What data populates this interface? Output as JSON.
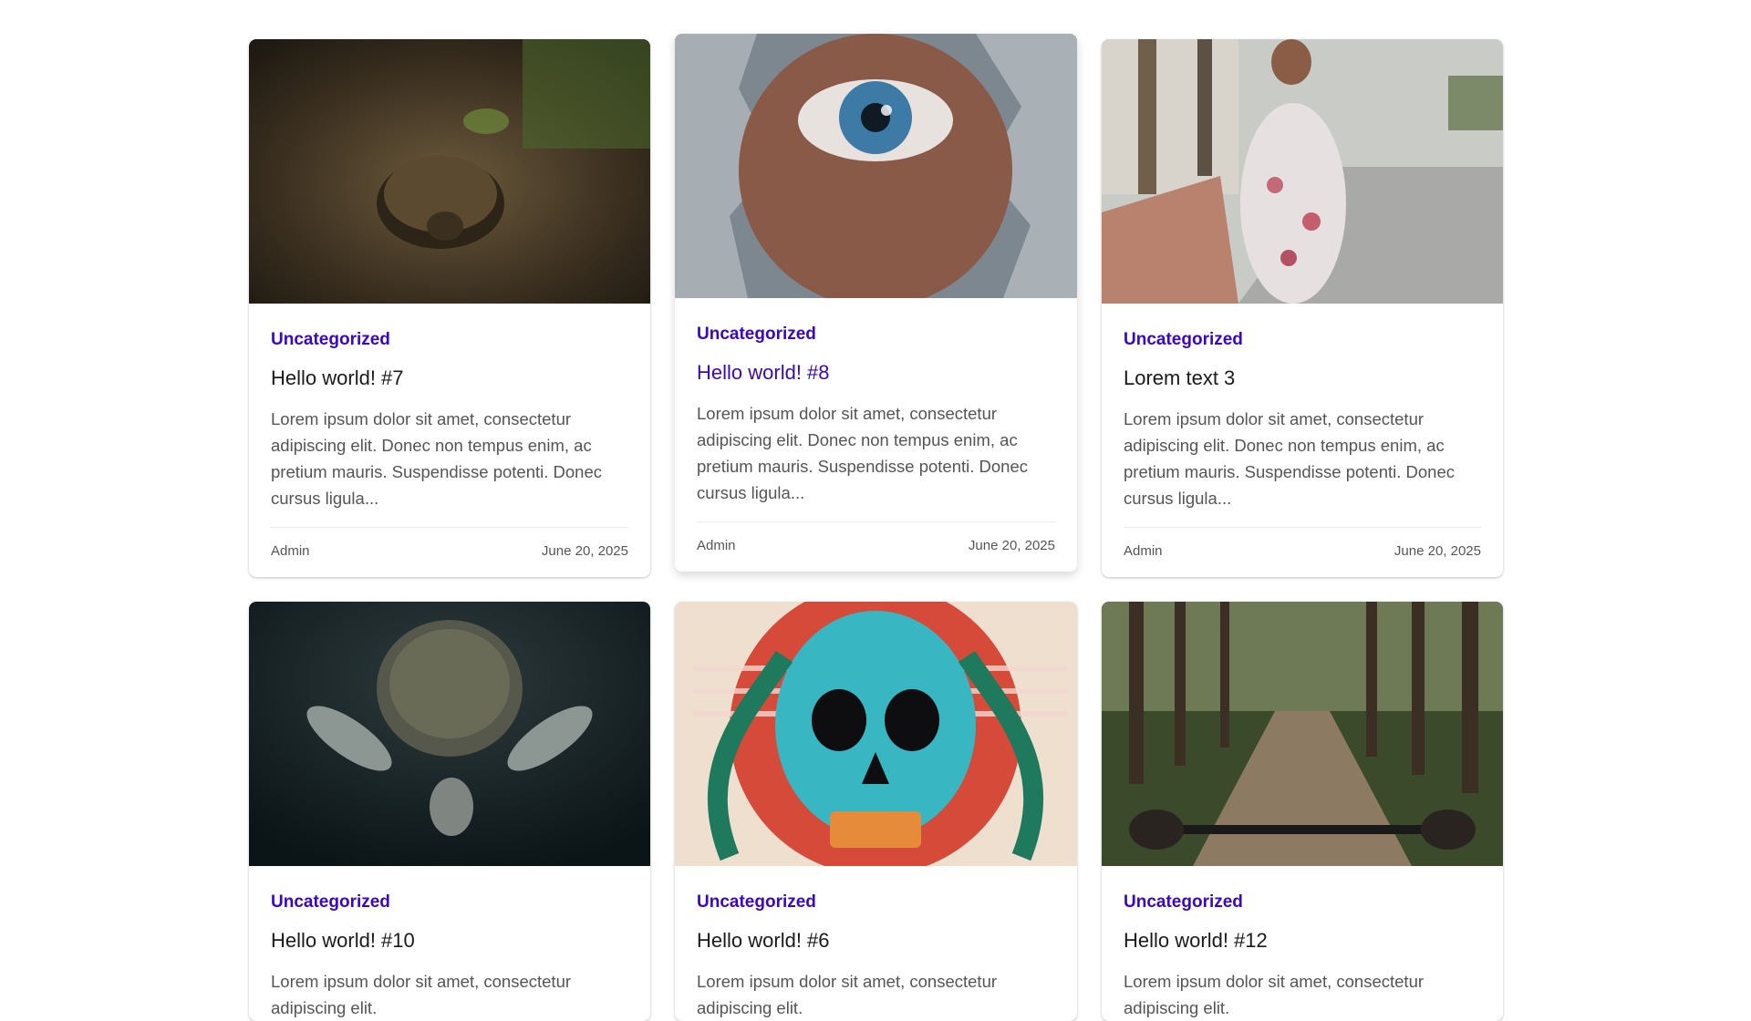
{
  "posts": [
    {
      "image": "tortoise-on-forest-path",
      "category": "Uncategorized",
      "title": "Hello world! #7",
      "excerpt": "Lorem ipsum dolor sit amet, consectetur adipiscing elit. Donec non tempus enim, ac pretium mauris. Suspendisse potenti. Donec cursus ligula...",
      "author": "Admin",
      "date": "June 20, 2025"
    },
    {
      "image": "eye-through-torn-wall",
      "category": "Uncategorized",
      "title": "Hello world! #8",
      "excerpt": "Lorem ipsum dolor sit amet, consectetur adipiscing elit. Donec non tempus enim, ac pretium mauris. Suspendisse potenti. Donec cursus ligula...",
      "author": "Admin",
      "date": "June 20, 2025"
    },
    {
      "image": "woman-floral-dress-street",
      "category": "Uncategorized",
      "title": "Lorem text 3",
      "excerpt": "Lorem ipsum dolor sit amet, consectetur adipiscing elit. Donec non tempus enim, ac pretium mauris. Suspendisse potenti. Donec cursus ligula...",
      "author": "Admin",
      "date": "June 20, 2025"
    },
    {
      "image": "sea-turtle-underwater",
      "category": "Uncategorized",
      "title": "Hello world! #10",
      "excerpt": "Lorem ipsum dolor sit amet, consectetur adipiscing elit.",
      "author": "",
      "date": ""
    },
    {
      "image": "skull-with-snake",
      "category": "Uncategorized",
      "title": "Hello world! #6",
      "excerpt": "Lorem ipsum dolor sit amet, consectetur adipiscing elit.",
      "author": "",
      "date": ""
    },
    {
      "image": "bike-ride-forest-path",
      "category": "Uncategorized",
      "title": "Hello world! #12",
      "excerpt": "Lorem ipsum dolor sit amet, consectetur adipiscing elit.",
      "author": "",
      "date": ""
    }
  ],
  "colors": {
    "accent": "#3a06c8",
    "text": "#1b1b1b",
    "muted": "#555555"
  }
}
